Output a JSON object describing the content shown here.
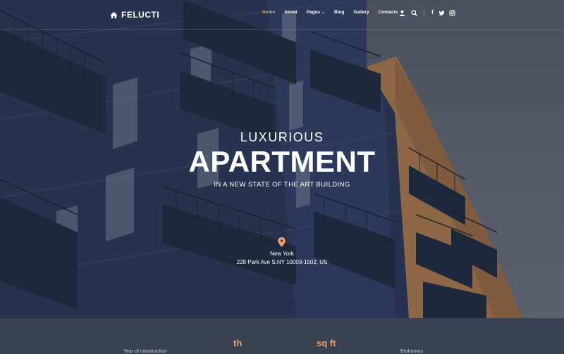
{
  "header": {
    "logo_text": "FELUCTI",
    "nav": [
      {
        "label": "Home",
        "active": true
      },
      {
        "label": "About"
      },
      {
        "label": "Pages",
        "dropdown": true
      },
      {
        "label": "Blog"
      },
      {
        "label": "Gallery"
      },
      {
        "label": "Contacts"
      }
    ],
    "icons": [
      "user-icon",
      "search-icon"
    ],
    "social": [
      "facebook-icon",
      "twitter-icon",
      "instagram-icon"
    ]
  },
  "hero": {
    "pretitle": "LUXURIOUS",
    "title": "APARTMENT",
    "subtitle": "IN A NEW STATE OF THE ART BUILDING",
    "location_icon": "map-pin-icon",
    "city": "New York",
    "address": "228 Park Ave S,NY 10003-1502, US"
  },
  "stats": [
    {
      "value": "th",
      "label": "Year of construction"
    },
    {
      "value": "sq ft",
      "label": ""
    },
    {
      "value": "",
      "label": "Bedrooms"
    }
  ],
  "colors": {
    "accent": "#f0a06a",
    "header_text": "#ffffff",
    "stats_background": "#3a4152",
    "building_blue": "#2e3d5e",
    "building_orange": "#c98a4e"
  }
}
